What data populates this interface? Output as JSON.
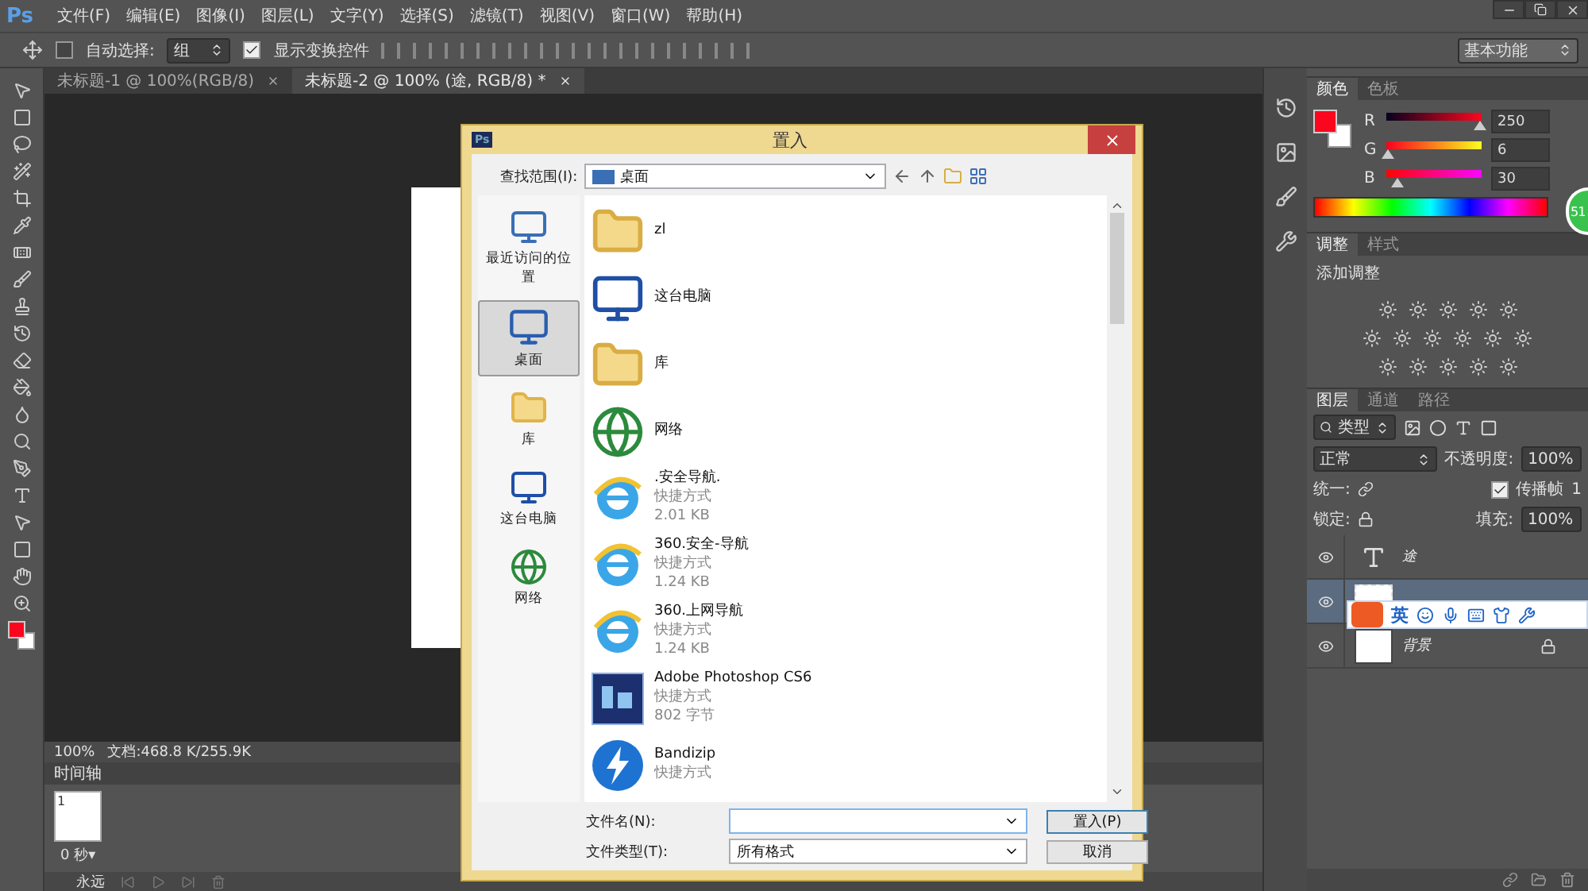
{
  "app": {
    "logo": "Ps",
    "menu": [
      "文件(F)",
      "编辑(E)",
      "图像(I)",
      "图层(L)",
      "文字(Y)",
      "选择(S)",
      "滤镜(T)",
      "视图(V)",
      "窗口(W)",
      "帮助(H)"
    ]
  },
  "options_bar": {
    "auto_select": {
      "label": "自动选择:",
      "checked": false
    },
    "auto_select_mode": "组",
    "show_transform": {
      "label": "显示变换控件",
      "checked": true
    },
    "workspace": "基本功能"
  },
  "tabs": [
    {
      "label": "未标题-1 @ 100%(RGB/8)",
      "selected": false
    },
    {
      "label": "未标题-2 @ 100% (途, RGB/8) *",
      "selected": true
    }
  ],
  "status_bar": {
    "zoom": "100%",
    "doc": "文档:468.8 K/255.9K"
  },
  "timeline": {
    "title": "时间轴",
    "frame_number": "1",
    "frame_delay": "0 秒▾",
    "loop": "永远"
  },
  "dialog": {
    "icon_label": "Ps",
    "title": "置入",
    "look_in_label": "查找范围(I):",
    "look_in": "桌面",
    "places": [
      {
        "label": "最近访问的位置",
        "kind": "recent",
        "selected": false
      },
      {
        "label": "桌面",
        "kind": "desktop",
        "selected": true
      },
      {
        "label": "库",
        "kind": "library",
        "selected": false
      },
      {
        "label": "这台电脑",
        "kind": "computer",
        "selected": false
      },
      {
        "label": "网络",
        "kind": "network",
        "selected": false
      }
    ],
    "files": [
      {
        "name": "zl",
        "kind": "user"
      },
      {
        "name": "这台电脑",
        "kind": "computer"
      },
      {
        "name": "库",
        "kind": "library"
      },
      {
        "name": "网络",
        "kind": "network"
      },
      {
        "name": ".安全导航.",
        "kind": "ie",
        "type": "快捷方式",
        "size": "2.01 KB"
      },
      {
        "name": "360.安全-导航",
        "kind": "ie",
        "type": "快捷方式",
        "size": "1.24 KB"
      },
      {
        "name": "360.上网导航",
        "kind": "ie",
        "type": "快捷方式",
        "size": "1.24 KB"
      },
      {
        "name": "Adobe Photoshop CS6",
        "kind": "ps",
        "type": "快捷方式",
        "size": "802 字节"
      },
      {
        "name": "Bandizip",
        "kind": "bandizip",
        "type": "快捷方式"
      }
    ],
    "filename_label": "文件名(N):",
    "filetype_label": "文件类型(T):",
    "filetype": "所有格式",
    "buttons": [
      "置入(P)",
      "取消"
    ]
  },
  "color_panel": {
    "tabs": [
      {
        "label": "颜色",
        "selected": true
      },
      {
        "label": "色板",
        "selected": false
      }
    ],
    "channels": [
      {
        "name": "R",
        "value": "250",
        "level": 0.98
      },
      {
        "name": "G",
        "value": "6",
        "level": 0.02
      },
      {
        "name": "B",
        "value": "30",
        "level": 0.12
      }
    ]
  },
  "adjustments_panel": {
    "tabs": [
      {
        "label": "调整",
        "selected": true
      },
      {
        "label": "样式",
        "selected": false
      }
    ],
    "heading": "添加调整"
  },
  "layers_panel": {
    "tabs": [
      {
        "label": "图层",
        "selected": true
      },
      {
        "label": "通道",
        "selected": false
      },
      {
        "label": "路径",
        "selected": false
      }
    ],
    "filter": "类型",
    "blend_mode": "正常",
    "opacity_label": "不透明度:",
    "opacity": "100%",
    "unify_label": "统一:",
    "propagate": {
      "label": "传播帧",
      "checked": true
    },
    "propagate_count": "1",
    "lock_label": "锁定:",
    "fill_label": "填充:",
    "fill": "100%",
    "layers": [
      {
        "name": "途",
        "kind": "text",
        "visible": true,
        "selected": false,
        "locked": false
      },
      {
        "kind": "image",
        "visible": true,
        "selected": true,
        "locked": false
      },
      {
        "name": "背景",
        "kind": "background",
        "visible": true,
        "selected": false,
        "locked": true
      }
    ]
  },
  "ime_bar": {
    "language": "英"
  },
  "badge": "51"
}
